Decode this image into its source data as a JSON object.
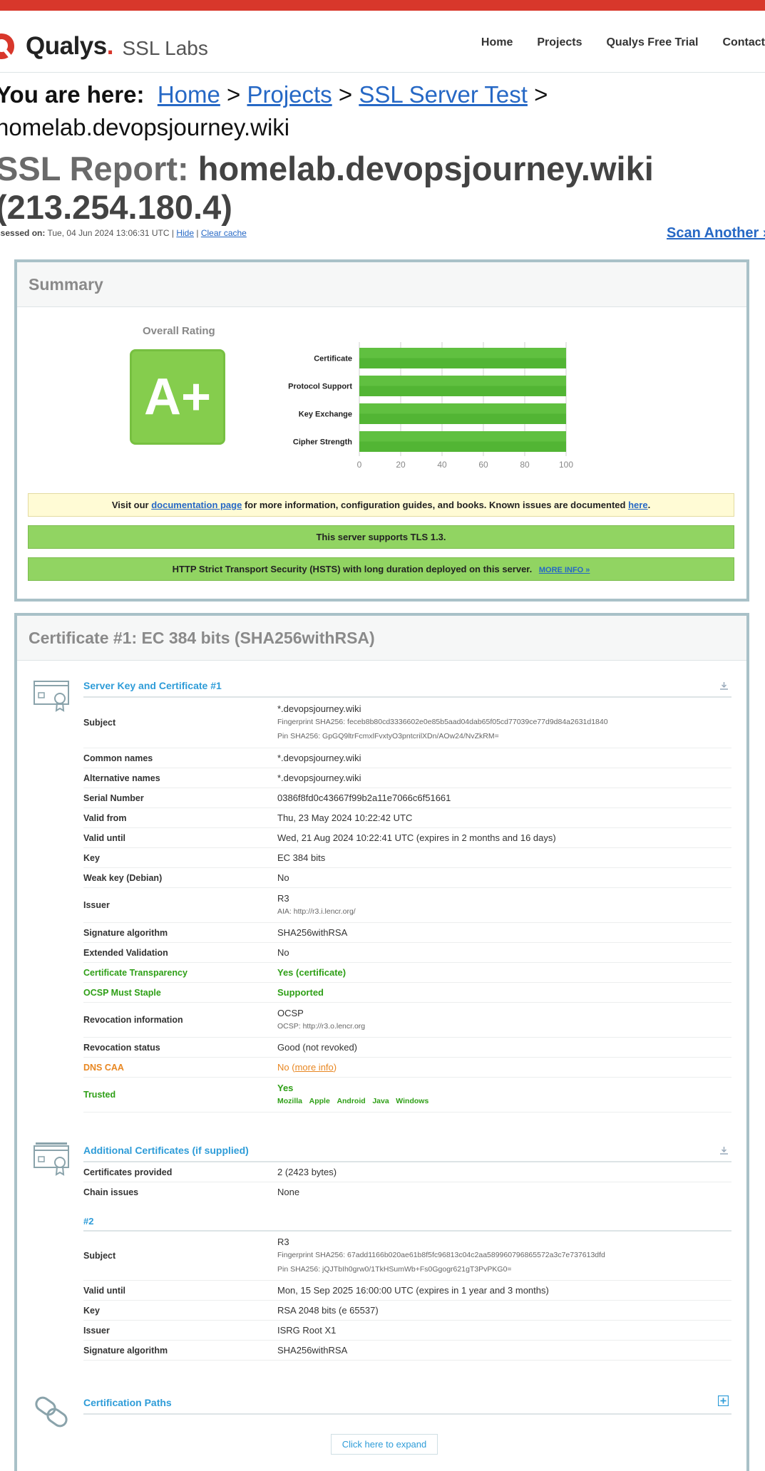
{
  "header": {
    "brand": "Qualys",
    "product": "SSL Labs",
    "nav": [
      "Home",
      "Projects",
      "Qualys Free Trial",
      "Contact"
    ]
  },
  "breadcrumb": {
    "label": "You are here:",
    "items": [
      "Home",
      "Projects",
      "SSL Server Test"
    ],
    "separator": ">",
    "current": "homelab.devopsjourney.wiki"
  },
  "report": {
    "title_prefix": "SSL Report:",
    "host": "homelab.devopsjourney.wiki",
    "ip": "(213.254.180.4)",
    "assessed_label": "ssessed on:",
    "assessed_value": "Tue, 04 Jun 2024 13:06:31 UTC",
    "sep": "|",
    "hide": "Hide",
    "clear_cache": "Clear cache",
    "scan_another": "Scan Another »"
  },
  "summary": {
    "title": "Summary",
    "overall_label": "Overall Rating",
    "grade": "A+",
    "grade_color": "#85cd4d",
    "notice_doc_pre": "Visit our",
    "notice_doc_link": "documentation page",
    "notice_doc_mid": "for more information, configuration guides, and books. Known issues are documented",
    "notice_doc_here": "here",
    "notice_doc_end": ".",
    "notice_tls": "This server supports TLS 1.3.",
    "notice_hsts": "HTTP Strict Transport Security (HSTS) with long duration deployed on this server.",
    "notice_hsts_link": "MORE INFO »"
  },
  "chart_data": {
    "type": "bar",
    "orientation": "horizontal",
    "categories": [
      "Certificate",
      "Protocol Support",
      "Key Exchange",
      "Cipher Strength"
    ],
    "values": [
      100,
      100,
      100,
      100
    ],
    "xlim": [
      0,
      100
    ],
    "ticks": [
      0,
      20,
      40,
      60,
      80,
      100
    ],
    "grid": true,
    "bar_color": "#52b534"
  },
  "certificate": {
    "title": "Certificate #1: EC 384 bits (SHA256withRSA)",
    "server_key_title": "Server Key and Certificate #1",
    "rows": {
      "subject_k": "Subject",
      "subject_v": "*.devopsjourney.wiki",
      "subject_fp": "Fingerprint SHA256: feceb8b80cd3336602e0e85b5aad04dab65f05cd77039ce77d9d84a2631d1840",
      "subject_pin": "Pin SHA256: GpGQ9ltrFcmxlFvxtyO3pntcrilXDn/AOw24/NvZkRM=",
      "cn_k": "Common names",
      "cn_v": "*.devopsjourney.wiki",
      "alt_k": "Alternative names",
      "alt_v": "*.devopsjourney.wiki",
      "serial_k": "Serial Number",
      "serial_v": "0386f8fd0c43667f99b2a11e7066c6f51661",
      "from_k": "Valid from",
      "from_v": "Thu, 23 May 2024 10:22:42 UTC",
      "until_k": "Valid until",
      "until_v": "Wed, 21 Aug 2024 10:22:41 UTC (expires in 2 months and 16 days)",
      "key_k": "Key",
      "key_v": "EC 384 bits",
      "weak_k": "Weak key (Debian)",
      "weak_v": "No",
      "issuer_k": "Issuer",
      "issuer_v": "R3",
      "issuer_aia": "AIA: http://r3.i.lencr.org/",
      "sig_k": "Signature algorithm",
      "sig_v": "SHA256withRSA",
      "ev_k": "Extended Validation",
      "ev_v": "No",
      "ct_k": "Certificate Transparency",
      "ct_v": "Yes (certificate)",
      "ocsp_k": "OCSP Must Staple",
      "ocsp_v": "Supported",
      "rev_k": "Revocation information",
      "rev_v": "OCSP",
      "rev_url": "OCSP: http://r3.o.lencr.org",
      "revs_k": "Revocation status",
      "revs_v": "Good (not revoked)",
      "caa_k": "DNS CAA",
      "caa_v": "No",
      "caa_link": "more info",
      "trusted_k": "Trusted",
      "trusted_v": "Yes",
      "platforms": [
        "Mozilla",
        "Apple",
        "Android",
        "Java",
        "Windows"
      ]
    },
    "additional_title": "Additional Certificates (if supplied)",
    "additional": {
      "provided_k": "Certificates provided",
      "provided_v": "2 (2423 bytes)",
      "chain_k": "Chain issues",
      "chain_v": "None",
      "sub": "#2",
      "subject_k": "Subject",
      "subject_v": "R3",
      "subject_fp": "Fingerprint SHA256: 67add1166b020ae61b8f5fc96813c04c2aa589960796865572a3c7e737613dfd",
      "subject_pin": "Pin SHA256: jQJTbIh0grw0/1TkHSumWb+Fs0Ggogr621gT3PvPKG0=",
      "until_k": "Valid until",
      "until_v": "Mon, 15 Sep 2025 16:00:00 UTC (expires in 1 year and 3 months)",
      "key_k": "Key",
      "key_v": "RSA 2048 bits (e 65537)",
      "issuer_k": "Issuer",
      "issuer_v": "ISRG Root X1",
      "sig_k": "Signature algorithm",
      "sig_v": "SHA256withRSA"
    },
    "paths_title": "Certification Paths",
    "expand": "Click here to expand"
  }
}
